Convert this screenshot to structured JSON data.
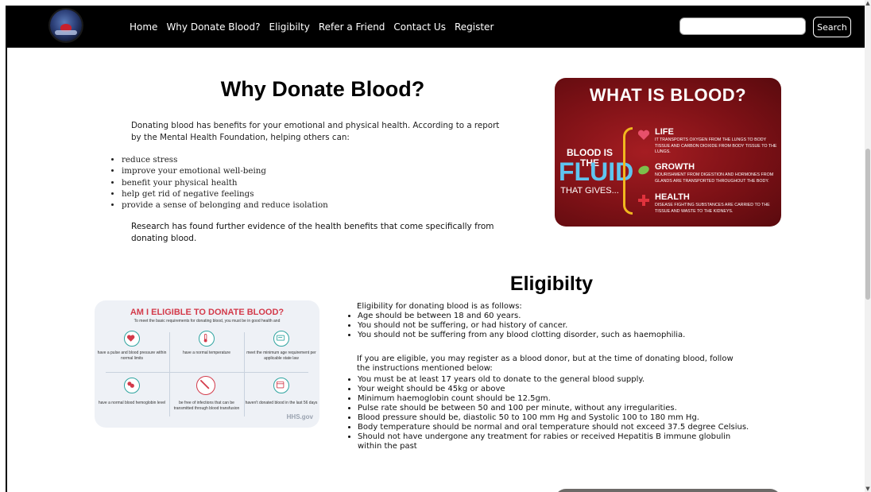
{
  "nav": {
    "items": [
      "Home",
      "Why Donate Blood?",
      "Eligibilty",
      "Refer a Friend",
      "Contact Us",
      "Register"
    ],
    "search_placeholder": "",
    "search_button": "Search"
  },
  "why": {
    "heading": "Why Donate Blood?",
    "intro": "Donating blood has benefits for your emotional and physical health. According to a report by the Mental Health Foundation, helping others can:",
    "benefits": [
      "reduce stress",
      "improve your emotional well-being",
      "benefit your physical health",
      "help get rid of negative feelings",
      "provide a sense of belonging and reduce isolation"
    ],
    "research": "Research has found further evidence of the health benefits that come specifically from donating blood."
  },
  "blood_image": {
    "title": "WHAT IS BLOOD?",
    "blood_is_the": "BLOOD IS THE",
    "fluid": "FLUID",
    "that_gives": "THAT GIVES...",
    "items": [
      {
        "heading": "LIFE",
        "text": "It transports oxygen from the lungs to body tissue and carbon dioxide from body tissue to the lungs.",
        "color": "#e8506a"
      },
      {
        "heading": "GROWTH",
        "text": "Nourishment from digestion and hormones from glands are transported throughout the body.",
        "color": "#7cc04b"
      },
      {
        "heading": "HEALTH",
        "text": "Disease fighting substances are carried to the tissue and waste to the kidneys.",
        "color": "#e0323c"
      }
    ]
  },
  "eligibility": {
    "heading": "Eligibilty",
    "image": {
      "title": "AM I ELIGIBLE TO DONATE BLOOD?",
      "subtitle": "To meet the basic requirements for donating blood, you must be in good health and",
      "cells": [
        "have a pulse and blood pressure within normal limits",
        "have a normal temperature",
        "meet the minimum age requirement per applicable state law",
        "have a normal blood hemoglobin level",
        "be free of infections that can be transmitted through blood transfusion",
        "haven't donated blood in the last 56 days"
      ],
      "logo": "HHS.gov"
    },
    "intro": "Eligibility for donating blood is as follows:",
    "rules": [
      "Age should be between 18 and 60 years.",
      "You should not be suffering, or had history of cancer.",
      "You should not be suffering from any blood clotting disorder, such as haemophilia."
    ],
    "note": "If you are eligible, you may register as a blood donor, but at the time of donating blood, follow the instructions mentioned below:",
    "instructions": [
      "You must be at least 17 years old to donate to the general blood supply.",
      "Your weight should be 45kg or above",
      "Minimum haemoglobin count should be 12.5gm.",
      "Pulse rate should be between 50 and 100 per minute, without any irregularities.",
      "Blood pressure should be, diastolic 50 to 100 mm Hg and Systolic 100 to 180 mm Hg.",
      "Body temperature should be normal and oral temperature should not exceed 37.5 degree Celsius.",
      "Should not have undergone any treatment for rabies or received Hepatitis B immune globulin within the past"
    ]
  },
  "colors": {
    "nav_bg": "#000000",
    "accent_red": "#a51d22",
    "fluid_blue": "#5fc5f0",
    "brace_yellow": "#f1b81f",
    "teal": "#2fa4a0"
  }
}
